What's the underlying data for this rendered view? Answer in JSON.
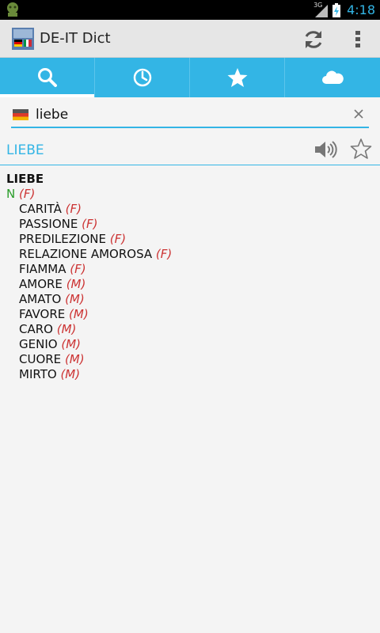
{
  "status_bar": {
    "network_label": "3G",
    "time": "4:18"
  },
  "action_bar": {
    "title": "DE-IT Dict",
    "icons": [
      "app-icon",
      "refresh-icon",
      "overflow-icon"
    ]
  },
  "tabs": [
    {
      "icon": "search-icon",
      "active": true
    },
    {
      "icon": "history-icon",
      "active": false
    },
    {
      "icon": "star-icon",
      "active": false
    },
    {
      "icon": "cloud-icon",
      "active": false
    }
  ],
  "search": {
    "flag": "german-flag-icon",
    "value": "liebe"
  },
  "headword": {
    "text": "LIEBE"
  },
  "entry": {
    "title": "LIEBE",
    "pos": "N",
    "pos_gender": "(F)",
    "translations": [
      {
        "word": "CARITÀ",
        "gender": "(F)"
      },
      {
        "word": "PASSIONE",
        "gender": "(F)"
      },
      {
        "word": "PREDILEZIONE",
        "gender": "(F)"
      },
      {
        "word": "RELAZIONE AMOROSA",
        "gender": "(F)"
      },
      {
        "word": "FIAMMA",
        "gender": "(F)"
      },
      {
        "word": "AMORE",
        "gender": "(M)"
      },
      {
        "word": "AMATO",
        "gender": "(M)"
      },
      {
        "word": "FAVORE",
        "gender": "(M)"
      },
      {
        "word": "CARO",
        "gender": "(M)"
      },
      {
        "word": "GENIO",
        "gender": "(M)"
      },
      {
        "word": "CUORE",
        "gender": "(M)"
      },
      {
        "word": "MIRTO",
        "gender": "(M)"
      }
    ]
  },
  "colors": {
    "accent": "#33b5e5",
    "pos": "#2a9d2a",
    "gender": "#cc3333"
  }
}
